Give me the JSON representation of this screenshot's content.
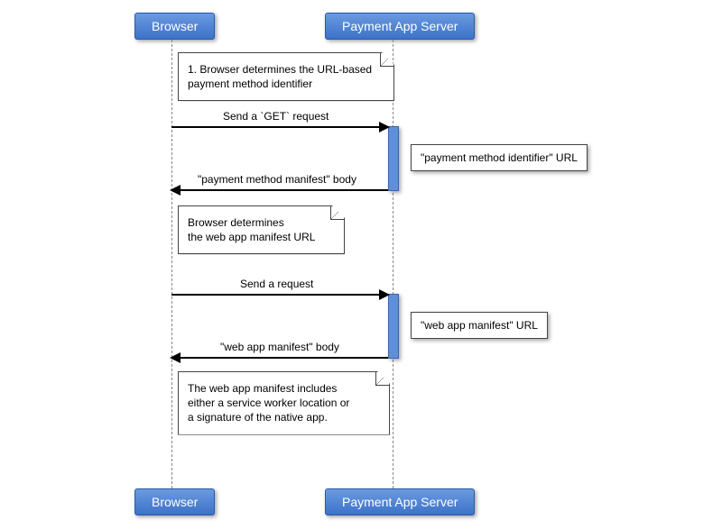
{
  "actors": {
    "browser": "Browser",
    "server": "Payment App Server"
  },
  "notes": {
    "n1a": "1. Browser determines the URL-based",
    "n1b": "payment method identifier",
    "n2a": "Browser determines",
    "n2b": "the web app manifest URL",
    "n3a": "The web app manifest includes",
    "n3b": "either a service worker location or",
    "n3c": "a signature of the native app."
  },
  "messages": {
    "m1": "Send a `GET` request",
    "m2": "\"payment method manifest\" body",
    "m3": "Send a request",
    "m4": "\"web app manifest\" body"
  },
  "sidenotes": {
    "s1": "\"payment method identifier\" URL",
    "s2": "\"web app manifest\" URL"
  },
  "chart_data": {
    "type": "sequence-diagram",
    "participants": [
      "Browser",
      "Payment App Server"
    ],
    "events": [
      {
        "type": "note",
        "on": "Browser",
        "text": "1. Browser determines the URL-based payment method identifier"
      },
      {
        "type": "message",
        "from": "Browser",
        "to": "Payment App Server",
        "text": "Send a `GET` request"
      },
      {
        "type": "note",
        "on": "Payment App Server",
        "text": "\"payment method identifier\" URL"
      },
      {
        "type": "message",
        "from": "Payment App Server",
        "to": "Browser",
        "text": "\"payment method manifest\" body"
      },
      {
        "type": "note",
        "on": "Browser",
        "text": "Browser determines the web app manifest URL"
      },
      {
        "type": "message",
        "from": "Browser",
        "to": "Payment App Server",
        "text": "Send a request"
      },
      {
        "type": "note",
        "on": "Payment App Server",
        "text": "\"web app manifest\" URL"
      },
      {
        "type": "message",
        "from": "Payment App Server",
        "to": "Browser",
        "text": "\"web app manifest\" body"
      },
      {
        "type": "note",
        "on": "Browser",
        "text": "The web app manifest includes either a service worker location or a signature of the native app."
      }
    ]
  }
}
